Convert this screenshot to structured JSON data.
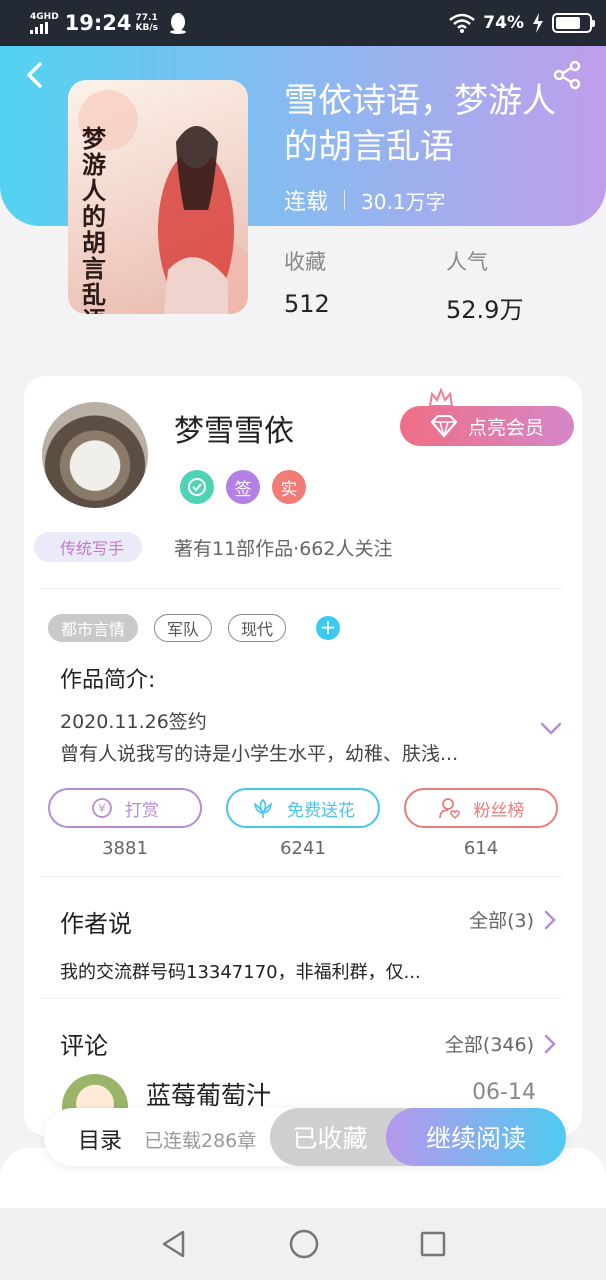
{
  "status_bar": {
    "network": "4G",
    "hd": "HD",
    "time": "19:24",
    "speed": "77.1",
    "speed_unit": "KB/s",
    "battery": "74%",
    "battery_level": 0.74
  },
  "book": {
    "title": "雪依诗语，梦游人的胡言乱语",
    "status": "连载",
    "words": "30.1万字",
    "stats": [
      {
        "label": "收藏",
        "value": "512"
      },
      {
        "label": "人气",
        "value": "52.9万"
      }
    ],
    "cover_text": "梦游人的胡言乱语"
  },
  "author": {
    "name": "梦雪雪依",
    "vip_label": "点亮会员",
    "badges": [
      {
        "text": "",
        "color": "#4fd3b7",
        "icon": "verified-icon"
      },
      {
        "text": "签",
        "color": "#b580e6"
      },
      {
        "text": "实",
        "color": "#f17b77"
      }
    ],
    "writer_tag": "传统写手",
    "summary": "著有11部作品·662人关注"
  },
  "tags": [
    "都市言情",
    "军队",
    "现代"
  ],
  "intro": {
    "title": "作品简介:",
    "line1": "2020.11.26签约",
    "line2": "曾有人说我写的诗是小学生水平，幼稚、肤浅..."
  },
  "actions": [
    {
      "label": "打赏",
      "count": "3881",
      "color": "#b78bd8",
      "icon": "reward-icon"
    },
    {
      "label": "免费送花",
      "count": "6241",
      "color": "#46c6e9",
      "icon": "flower-icon"
    },
    {
      "label": "粉丝榜",
      "count": "614",
      "color": "#ec7c7c",
      "icon": "fans-icon"
    }
  ],
  "author_says": {
    "title": "作者说",
    "more": "全部(3)",
    "text": "我的交流群号码13347170，非福利群，仅..."
  },
  "comments": {
    "title": "评论",
    "more": "全部(346)",
    "first": {
      "name": "蓝莓葡萄汁",
      "date": "06-14"
    }
  },
  "bottom_bar": {
    "toc": "目录",
    "chapters": "已连载286章",
    "favorited": "已收藏",
    "read": "继续阅读"
  }
}
